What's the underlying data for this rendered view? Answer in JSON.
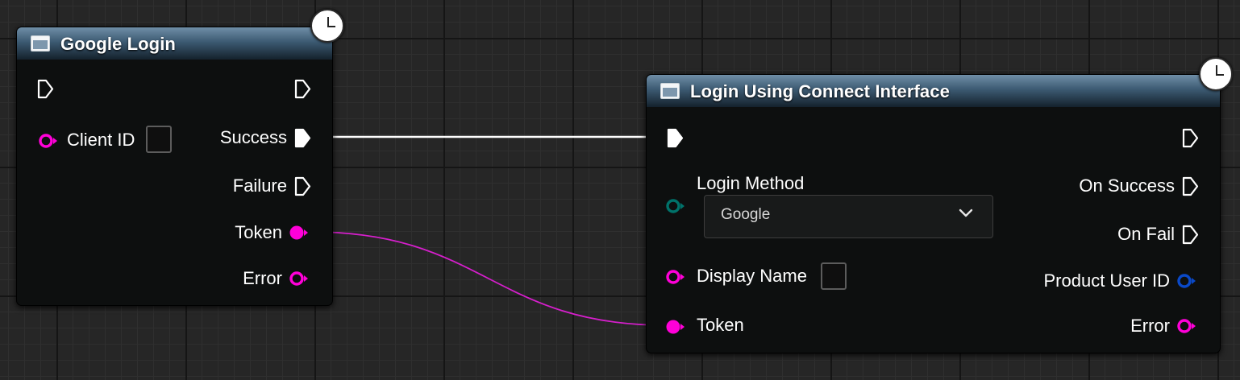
{
  "colors": {
    "exec_pin": "#ffffff",
    "string_pin": "#ff00d8",
    "enum_pin": "#00726a",
    "struct_pin": "#0a49c8",
    "string_wire": "#d61fcc",
    "exec_wire": "#ffffff",
    "header_gradient_top": "#6f8ea7",
    "header_gradient_bottom": "#14212c"
  },
  "google_login": {
    "title": "Google Login",
    "icon": "function-icon",
    "latent_icon": "clock-icon",
    "inputs": {
      "client_id": {
        "label": "Client ID",
        "checked": false
      }
    },
    "outputs": {
      "success": "Success",
      "failure": "Failure",
      "token": "Token",
      "error": "Error"
    }
  },
  "login_connect": {
    "title": "Login Using Connect Interface",
    "icon": "function-icon",
    "latent_icon": "clock-icon",
    "inputs": {
      "login_method": {
        "label": "Login Method",
        "selected": "Google"
      },
      "display_name": {
        "label": "Display Name",
        "checked": false
      },
      "token": "Token"
    },
    "outputs": {
      "on_success": "On Success",
      "on_fail": "On Fail",
      "product_user_id": "Product User ID",
      "error": "Error"
    }
  },
  "connections": [
    {
      "from": "google_login.success",
      "to": "login_connect.exec_in",
      "kind": "exec"
    },
    {
      "from": "google_login.token",
      "to": "login_connect.token",
      "kind": "string"
    }
  ]
}
